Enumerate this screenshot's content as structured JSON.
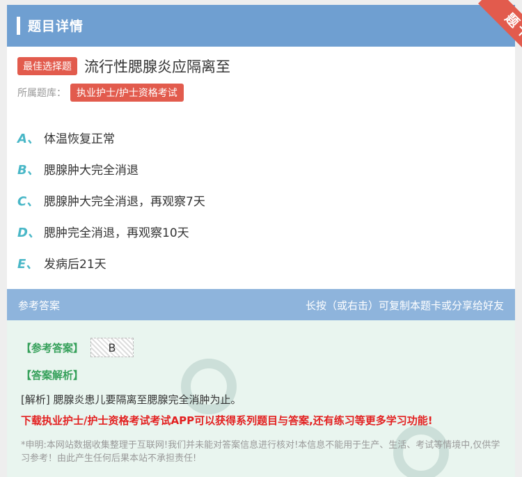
{
  "header": {
    "title": "题目详情",
    "corner_label": "题卡"
  },
  "question": {
    "type_badge": "最佳选择题",
    "text": "流行性腮腺炎应隔离至",
    "library_label": "所属题库：",
    "library_name": "执业护士/护士资格考试"
  },
  "options": [
    {
      "letter": "A、",
      "text": "体温恢复正常"
    },
    {
      "letter": "B、",
      "text": "腮腺肿大完全消退"
    },
    {
      "letter": "C、",
      "text": "腮腺肿大完全消退，再观察7天"
    },
    {
      "letter": "D、",
      "text": "腮肿完全消退，再观察10天"
    },
    {
      "letter": "E、",
      "text": "发病后21天"
    }
  ],
  "answer_section": {
    "title": "参考答案",
    "hint": "长按（或右击）可复制本题卡或分享给好友",
    "answer_tag": "【参考答案】",
    "answer_value": "B",
    "analysis_tag": "【答案解析】",
    "analysis_text": "[解析] 腮腺炎患儿要隔离至腮腺完全消肿为止。",
    "promo": "下载执业护士/护士资格考试考试APP可以获得系列题目与答案,还有练习等更多学习功能!",
    "disclaimer": "*申明:本网站数据收集整理于互联网!我们并未能对答案信息进行核对!本信息不能用于生产、生活、考试等情境中,仅供学习参考！由此产生任何后果本站不承担责任!"
  },
  "colors": {
    "header": "#6f9fd1",
    "accent_red": "#e25b4d",
    "option_letter": "#49b7c7",
    "answer_green": "#35a05a"
  }
}
